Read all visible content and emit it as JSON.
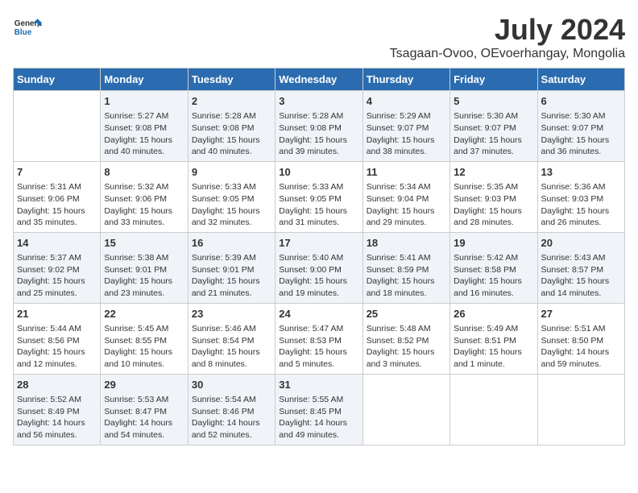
{
  "header": {
    "logo_general": "General",
    "logo_blue": "Blue",
    "month_year": "July 2024",
    "location": "Tsagaan-Ovoo, OEvoerhangay, Mongolia"
  },
  "days_of_week": [
    "Sunday",
    "Monday",
    "Tuesday",
    "Wednesday",
    "Thursday",
    "Friday",
    "Saturday"
  ],
  "weeks": [
    [
      {
        "day": "",
        "info": ""
      },
      {
        "day": "1",
        "info": "Sunrise: 5:27 AM\nSunset: 9:08 PM\nDaylight: 15 hours\nand 40 minutes."
      },
      {
        "day": "2",
        "info": "Sunrise: 5:28 AM\nSunset: 9:08 PM\nDaylight: 15 hours\nand 40 minutes."
      },
      {
        "day": "3",
        "info": "Sunrise: 5:28 AM\nSunset: 9:08 PM\nDaylight: 15 hours\nand 39 minutes."
      },
      {
        "day": "4",
        "info": "Sunrise: 5:29 AM\nSunset: 9:07 PM\nDaylight: 15 hours\nand 38 minutes."
      },
      {
        "day": "5",
        "info": "Sunrise: 5:30 AM\nSunset: 9:07 PM\nDaylight: 15 hours\nand 37 minutes."
      },
      {
        "day": "6",
        "info": "Sunrise: 5:30 AM\nSunset: 9:07 PM\nDaylight: 15 hours\nand 36 minutes."
      }
    ],
    [
      {
        "day": "7",
        "info": "Sunrise: 5:31 AM\nSunset: 9:06 PM\nDaylight: 15 hours\nand 35 minutes."
      },
      {
        "day": "8",
        "info": "Sunrise: 5:32 AM\nSunset: 9:06 PM\nDaylight: 15 hours\nand 33 minutes."
      },
      {
        "day": "9",
        "info": "Sunrise: 5:33 AM\nSunset: 9:05 PM\nDaylight: 15 hours\nand 32 minutes."
      },
      {
        "day": "10",
        "info": "Sunrise: 5:33 AM\nSunset: 9:05 PM\nDaylight: 15 hours\nand 31 minutes."
      },
      {
        "day": "11",
        "info": "Sunrise: 5:34 AM\nSunset: 9:04 PM\nDaylight: 15 hours\nand 29 minutes."
      },
      {
        "day": "12",
        "info": "Sunrise: 5:35 AM\nSunset: 9:03 PM\nDaylight: 15 hours\nand 28 minutes."
      },
      {
        "day": "13",
        "info": "Sunrise: 5:36 AM\nSunset: 9:03 PM\nDaylight: 15 hours\nand 26 minutes."
      }
    ],
    [
      {
        "day": "14",
        "info": "Sunrise: 5:37 AM\nSunset: 9:02 PM\nDaylight: 15 hours\nand 25 minutes."
      },
      {
        "day": "15",
        "info": "Sunrise: 5:38 AM\nSunset: 9:01 PM\nDaylight: 15 hours\nand 23 minutes."
      },
      {
        "day": "16",
        "info": "Sunrise: 5:39 AM\nSunset: 9:01 PM\nDaylight: 15 hours\nand 21 minutes."
      },
      {
        "day": "17",
        "info": "Sunrise: 5:40 AM\nSunset: 9:00 PM\nDaylight: 15 hours\nand 19 minutes."
      },
      {
        "day": "18",
        "info": "Sunrise: 5:41 AM\nSunset: 8:59 PM\nDaylight: 15 hours\nand 18 minutes."
      },
      {
        "day": "19",
        "info": "Sunrise: 5:42 AM\nSunset: 8:58 PM\nDaylight: 15 hours\nand 16 minutes."
      },
      {
        "day": "20",
        "info": "Sunrise: 5:43 AM\nSunset: 8:57 PM\nDaylight: 15 hours\nand 14 minutes."
      }
    ],
    [
      {
        "day": "21",
        "info": "Sunrise: 5:44 AM\nSunset: 8:56 PM\nDaylight: 15 hours\nand 12 minutes."
      },
      {
        "day": "22",
        "info": "Sunrise: 5:45 AM\nSunset: 8:55 PM\nDaylight: 15 hours\nand 10 minutes."
      },
      {
        "day": "23",
        "info": "Sunrise: 5:46 AM\nSunset: 8:54 PM\nDaylight: 15 hours\nand 8 minutes."
      },
      {
        "day": "24",
        "info": "Sunrise: 5:47 AM\nSunset: 8:53 PM\nDaylight: 15 hours\nand 5 minutes."
      },
      {
        "day": "25",
        "info": "Sunrise: 5:48 AM\nSunset: 8:52 PM\nDaylight: 15 hours\nand 3 minutes."
      },
      {
        "day": "26",
        "info": "Sunrise: 5:49 AM\nSunset: 8:51 PM\nDaylight: 15 hours\nand 1 minute."
      },
      {
        "day": "27",
        "info": "Sunrise: 5:51 AM\nSunset: 8:50 PM\nDaylight: 14 hours\nand 59 minutes."
      }
    ],
    [
      {
        "day": "28",
        "info": "Sunrise: 5:52 AM\nSunset: 8:49 PM\nDaylight: 14 hours\nand 56 minutes."
      },
      {
        "day": "29",
        "info": "Sunrise: 5:53 AM\nSunset: 8:47 PM\nDaylight: 14 hours\nand 54 minutes."
      },
      {
        "day": "30",
        "info": "Sunrise: 5:54 AM\nSunset: 8:46 PM\nDaylight: 14 hours\nand 52 minutes."
      },
      {
        "day": "31",
        "info": "Sunrise: 5:55 AM\nSunset: 8:45 PM\nDaylight: 14 hours\nand 49 minutes."
      },
      {
        "day": "",
        "info": ""
      },
      {
        "day": "",
        "info": ""
      },
      {
        "day": "",
        "info": ""
      }
    ]
  ]
}
